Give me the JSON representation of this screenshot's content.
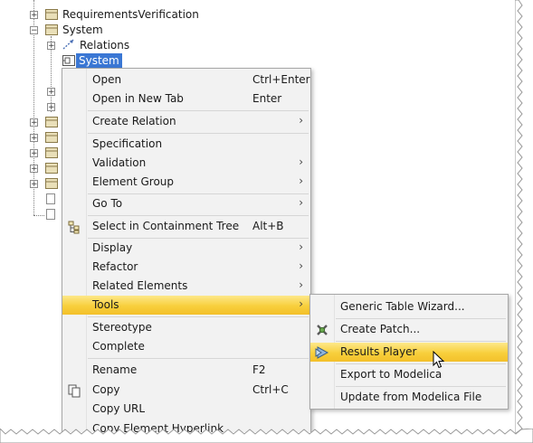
{
  "tree": {
    "nodes": [
      {
        "label": "RequirementsVerification"
      },
      {
        "label": "System"
      },
      {
        "label": "Relations"
      },
      {
        "label": "System",
        "selected": true
      }
    ]
  },
  "context_menu": {
    "items": [
      {
        "label": "Open",
        "shortcut": "Ctrl+Enter"
      },
      {
        "label": "Open in New Tab",
        "shortcut": "Enter"
      },
      {
        "label": "Create Relation",
        "submenu": true
      },
      {
        "label": "Specification"
      },
      {
        "label": "Validation",
        "submenu": true
      },
      {
        "label": "Element Group",
        "submenu": true
      },
      {
        "label": "Go To",
        "submenu": true
      },
      {
        "label": "Select in Containment Tree",
        "shortcut": "Alt+B",
        "icon": "containment-tree-icon"
      },
      {
        "label": "Display",
        "submenu": true
      },
      {
        "label": "Refactor",
        "submenu": true
      },
      {
        "label": "Related Elements",
        "submenu": true
      },
      {
        "label": "Tools",
        "submenu": true,
        "highlighted": true
      },
      {
        "label": "Stereotype"
      },
      {
        "label": "Complete"
      },
      {
        "label": "Rename",
        "shortcut": "F2"
      },
      {
        "label": "Copy",
        "shortcut": "Ctrl+C",
        "icon": "copy-icon"
      },
      {
        "label": "Copy URL"
      },
      {
        "label": "Copy Element Hyperlink"
      }
    ],
    "arrow": "›"
  },
  "tools_submenu": {
    "items": [
      {
        "label": "Generic Table Wizard..."
      },
      {
        "label": "Create Patch...",
        "icon": "create-patch-icon"
      },
      {
        "label": "Results Player",
        "icon": "results-player-icon",
        "highlighted": true
      },
      {
        "label": "Export to Modelica"
      },
      {
        "label": "Update from Modelica File"
      }
    ]
  },
  "colors": {
    "selection": "#3a77d4",
    "highlight": "#f8cf3c",
    "menu_bg": "#f2f2f2"
  }
}
